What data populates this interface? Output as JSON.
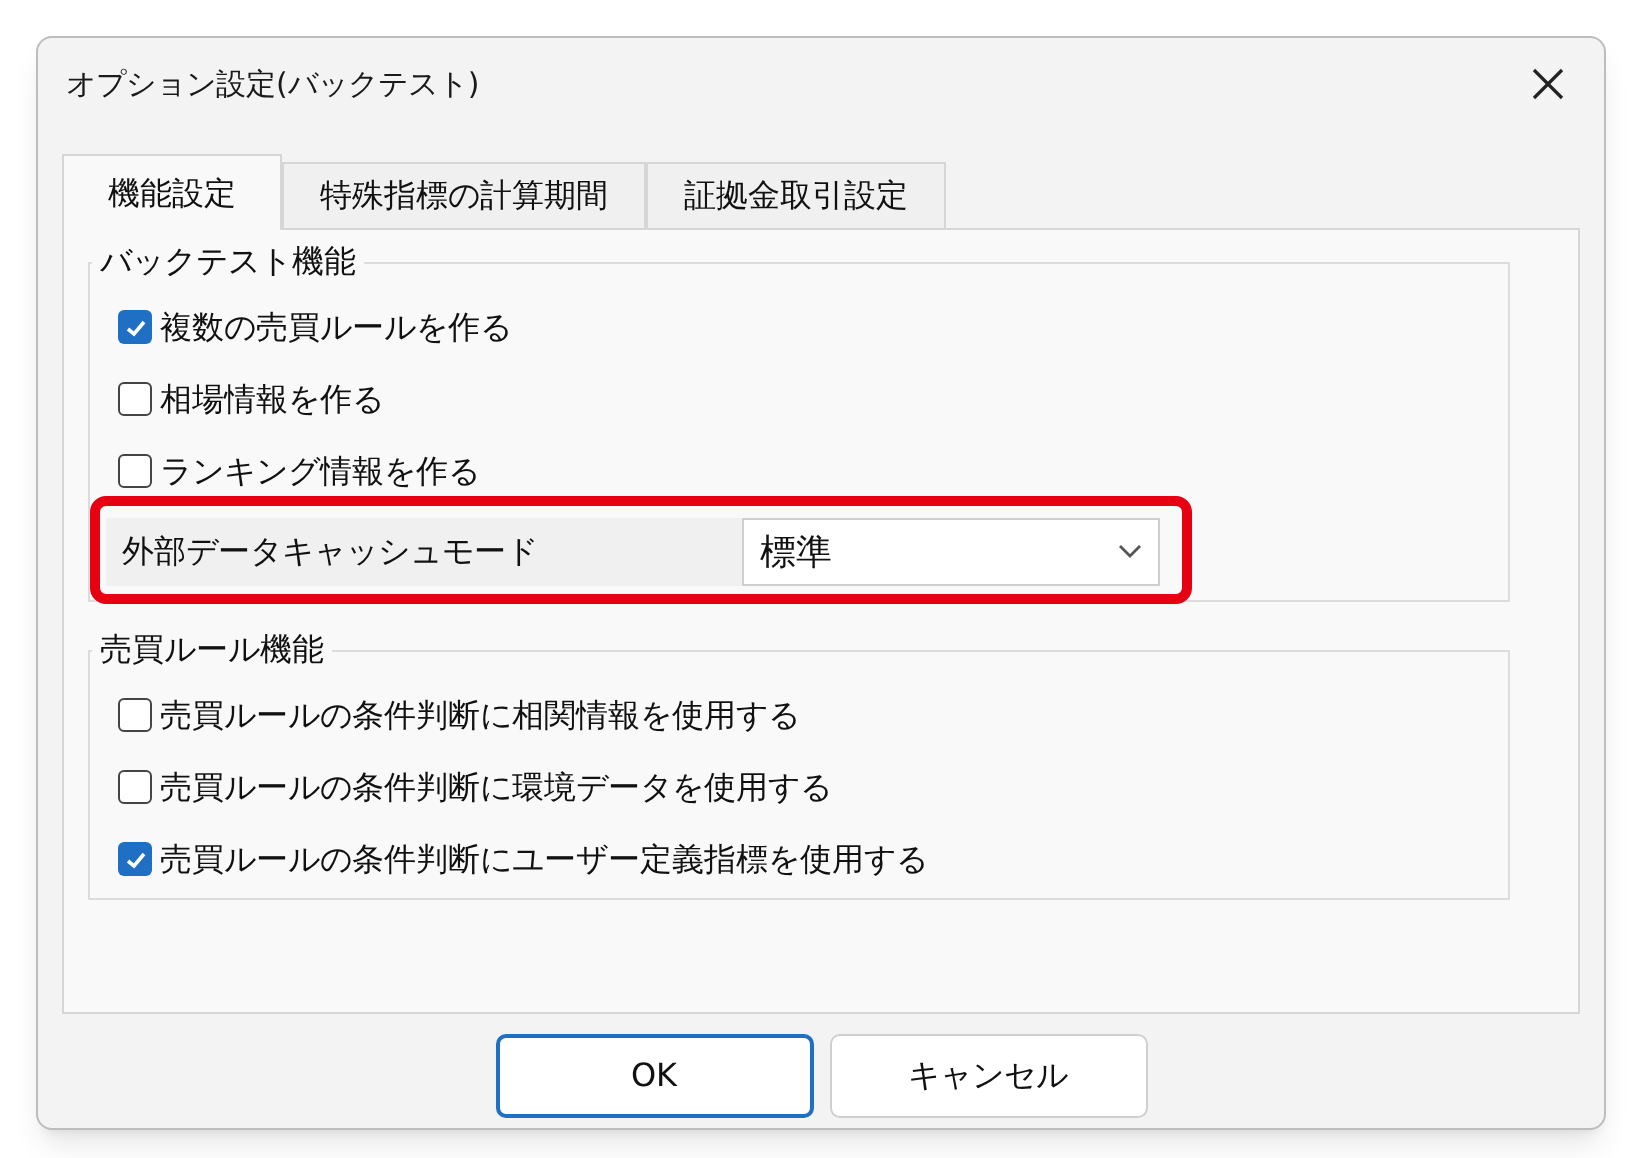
{
  "window": {
    "title": "オプション設定(バックテスト)"
  },
  "tabs": [
    {
      "label": "機能設定",
      "selected": true
    },
    {
      "label": "特殊指標の計算期間",
      "selected": false
    },
    {
      "label": "証拠金取引設定",
      "selected": false
    }
  ],
  "groups": [
    {
      "title": "バックテスト機能",
      "items": [
        {
          "kind": "checkbox",
          "label": "複数の売買ルールを作る",
          "checked": true
        },
        {
          "kind": "checkbox",
          "label": "相場情報を作る",
          "checked": false
        },
        {
          "kind": "checkbox",
          "label": "ランキング情報を作る",
          "checked": false
        },
        {
          "kind": "select",
          "label": "外部データキャッシュモード",
          "value": "標準",
          "highlighted": true
        }
      ]
    },
    {
      "title": "売買ルール機能",
      "items": [
        {
          "kind": "checkbox",
          "label": "売買ルールの条件判断に相関情報を使用する",
          "checked": false
        },
        {
          "kind": "checkbox",
          "label": "売買ルールの条件判断に環境データを使用する",
          "checked": false
        },
        {
          "kind": "checkbox",
          "label": "売買ルールの条件判断にユーザー定義指標を使用する",
          "checked": true
        }
      ]
    }
  ],
  "buttons": [
    {
      "label": "OK",
      "default": true
    },
    {
      "label": "キャンセル",
      "default": false
    }
  ]
}
